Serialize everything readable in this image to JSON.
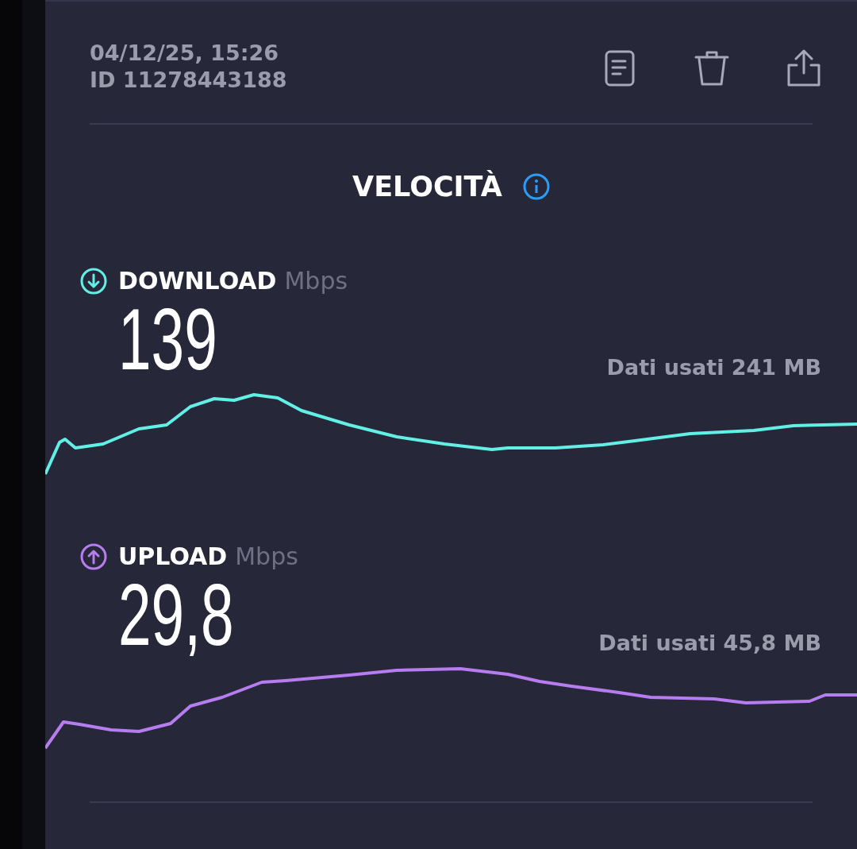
{
  "header": {
    "date": "04/12/25, 15:26",
    "id": "ID 11278443188"
  },
  "section_title": "VELOCITÀ",
  "metrics": [
    {
      "kind": "download",
      "label": "DOWNLOAD",
      "unit": "Mbps",
      "value": "139",
      "data_used": "Dati usati 241 MB",
      "color": "#62efe6"
    },
    {
      "kind": "upload",
      "label": "UPLOAD",
      "unit": "Mbps",
      "value": "29,8",
      "data_used": "Dati usati 45,8 MB",
      "color": "#b77cf0"
    }
  ]
}
